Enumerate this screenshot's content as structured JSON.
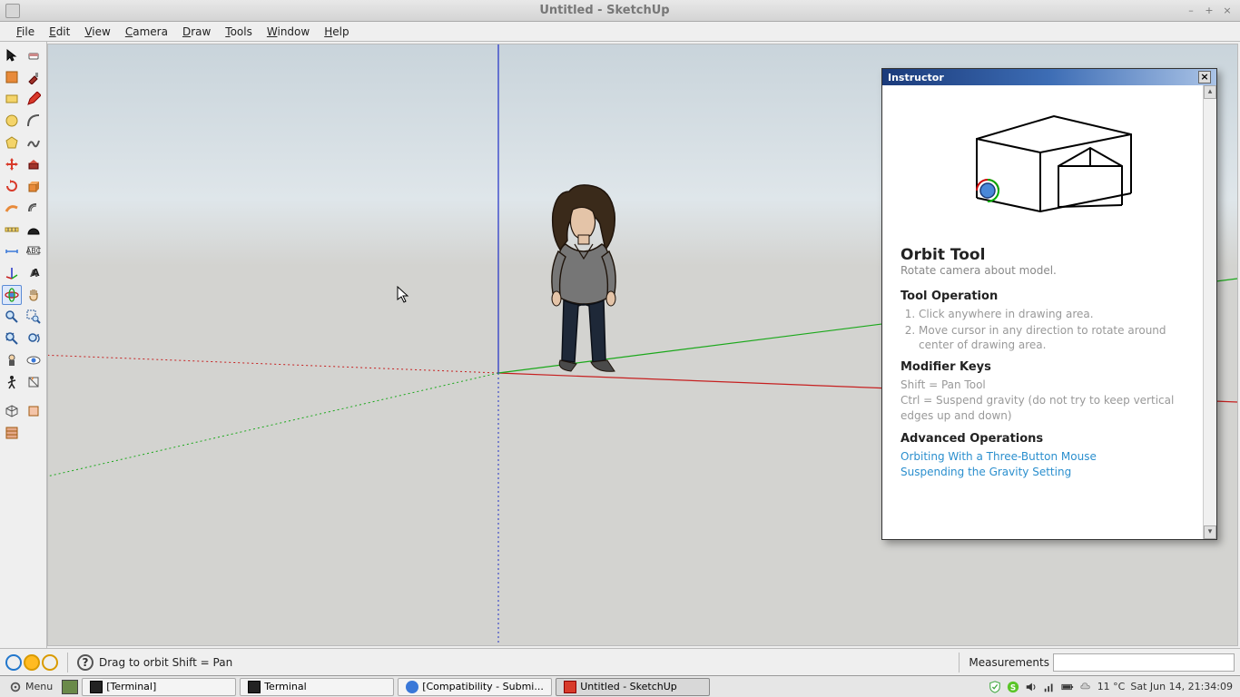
{
  "title": "Untitled - SketchUp",
  "menus": [
    "File",
    "Edit",
    "View",
    "Camera",
    "Draw",
    "Tools",
    "Window",
    "Help"
  ],
  "instructor": {
    "panel_title": "Instructor",
    "tool_name": "Orbit Tool",
    "subtitle": "Rotate camera about model.",
    "operation_heading": "Tool Operation",
    "operation_steps": [
      "Click anywhere in drawing area.",
      "Move cursor in any direction to rotate around center of drawing area."
    ],
    "modifier_heading": "Modifier Keys",
    "modifier_lines": [
      "Shift = Pan Tool",
      "Ctrl = Suspend gravity (do not try to keep vertical edges up and down)"
    ],
    "advanced_heading": "Advanced Operations",
    "advanced_links": [
      "Orbiting With a Three-Button Mouse",
      "Suspending the Gravity Setting"
    ]
  },
  "status": {
    "hint": "Drag to orbit  Shift = Pan",
    "measurements_label": "Measurements",
    "measurements_value": ""
  },
  "taskbar": {
    "menu_label": "Menu",
    "tasks": [
      {
        "label": "[Terminal]",
        "kind": "terminal"
      },
      {
        "label": "Terminal",
        "kind": "terminal"
      },
      {
        "label": "[Compatibility - Submi...",
        "kind": "browser"
      },
      {
        "label": "Untitled - SketchUp",
        "kind": "sketchup"
      }
    ],
    "weather": "11 °C",
    "clock": "Sat Jun 14, 21:34:09"
  },
  "tools": [
    [
      "select",
      "eraser"
    ],
    [
      "line",
      "paint"
    ],
    [
      "rectangle",
      "pencil"
    ],
    [
      "circle",
      "arc"
    ],
    [
      "polygon",
      "freehand"
    ],
    [
      "move",
      "rotate-red"
    ],
    [
      "rotate",
      "pushpull"
    ],
    [
      "followme",
      "offset"
    ],
    [
      "tape",
      "protractor"
    ],
    [
      "dimension",
      "text"
    ],
    [
      "axes",
      "3dtext"
    ],
    [
      "orbit",
      "pan"
    ],
    [
      "zoom",
      "zoom-window"
    ],
    [
      "zoom-extents",
      "previous"
    ],
    [
      "position",
      "lookaround"
    ],
    [
      "walk",
      "section"
    ],
    [],
    [
      "iso",
      "front"
    ],
    [
      "texture",
      ""
    ]
  ],
  "selected_tool": "orbit"
}
